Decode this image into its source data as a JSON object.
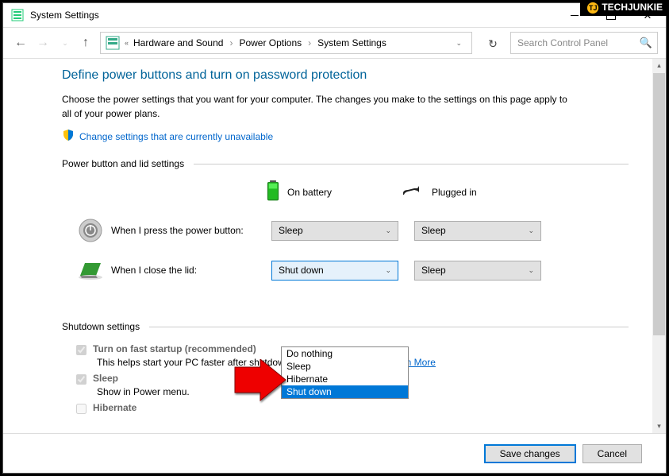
{
  "watermark": "TECHJUNKIE",
  "titlebar": {
    "title": "System Settings"
  },
  "nav": {
    "crumbs": [
      "Hardware and Sound",
      "Power Options",
      "System Settings"
    ],
    "refresh_tooltip": "Refresh"
  },
  "search": {
    "placeholder": "Search Control Panel"
  },
  "main": {
    "heading": "Define power buttons and turn on password protection",
    "subtext": "Choose the power settings that you want for your computer. The changes you make to the settings on this page apply to all of your power plans.",
    "shield_link": "Change settings that are currently unavailable",
    "section1_label": "Power button and lid settings",
    "col_battery": "On battery",
    "col_plugged": "Plugged in",
    "row1_label": "When I press the power button:",
    "row2_label": "When I close the lid:",
    "combo1_battery": "Sleep",
    "combo1_plugged": "Sleep",
    "combo2_battery": "Shut down",
    "combo2_plugged": "Sleep",
    "dropdown_options": [
      "Do nothing",
      "Sleep",
      "Hibernate",
      "Shut down"
    ],
    "section2_label": "Shutdown settings",
    "opt_fast": "Turn on fast startup (recommended)",
    "opt_fast_desc": "This helps start your PC faster after shutdown. Restart isn't affected. ",
    "opt_fast_link": "Learn More",
    "opt_sleep": "Sleep",
    "opt_sleep_desc": "Show in Power menu.",
    "opt_hibernate": "Hibernate"
  },
  "footer": {
    "save": "Save changes",
    "cancel": "Cancel"
  }
}
